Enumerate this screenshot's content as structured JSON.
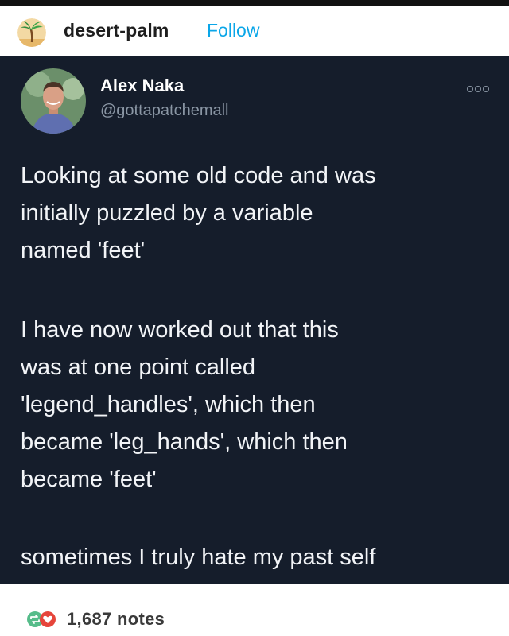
{
  "header": {
    "blog_name": "desert-palm",
    "follow_label": "Follow"
  },
  "tweet": {
    "author_name": "Alex Naka",
    "author_handle": "@gottapatchemall",
    "paragraphs": [
      [
        "Looking at some old code and was",
        "initially puzzled by a variable",
        "named 'feet'"
      ],
      [
        "I have now worked out that this",
        "was at one point called",
        "'legend_handles', which then",
        "became 'leg_hands', which then",
        "became 'feet'"
      ],
      [
        "sometimes I truly hate my past self"
      ]
    ]
  },
  "footer": {
    "notes": "1,687 notes"
  },
  "colors": {
    "tweet_background": "#151d2b",
    "follow_blue": "#0aa6e8",
    "reblog_green": "#56bc8a",
    "like_red": "#e6453b"
  },
  "icons": {
    "blog_avatar": "palm-tree-avatar",
    "author_avatar": "profile-photo",
    "more": "more-options-icon",
    "reblog": "reblog-icon",
    "like": "heart-icon"
  }
}
